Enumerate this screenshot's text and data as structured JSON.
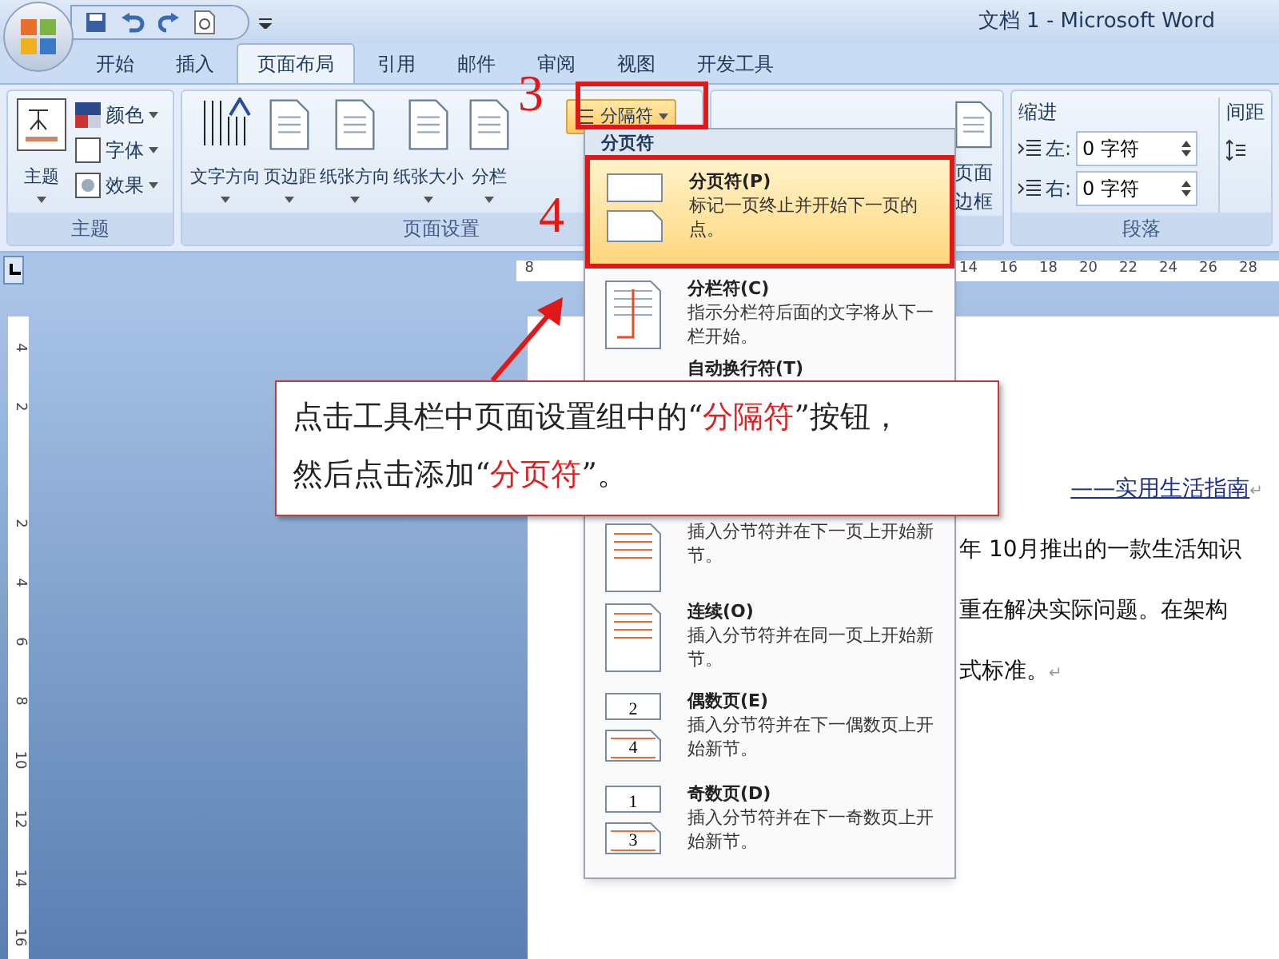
{
  "title_bar": {
    "title": "文档 1 - Microsoft Word"
  },
  "tabs": [
    {
      "label": "开始",
      "selected": false
    },
    {
      "label": "插入",
      "selected": false
    },
    {
      "label": "页面布局",
      "selected": true
    },
    {
      "label": "引用",
      "selected": false
    },
    {
      "label": "邮件",
      "selected": false
    },
    {
      "label": "审阅",
      "selected": false
    },
    {
      "label": "视图",
      "selected": false
    },
    {
      "label": "开发工具",
      "selected": false
    }
  ],
  "ribbon": {
    "theme_group": {
      "label": "主题",
      "big_button": "主题",
      "small_buttons": [
        "颜色",
        "字体",
        "效果"
      ]
    },
    "page_setup_group": {
      "label": "页面设置",
      "buttons": [
        "文字方向",
        "页边距",
        "纸张方向",
        "纸张大小",
        "分栏"
      ],
      "breaks_button": "分隔符"
    },
    "page_background_group": {
      "page_borders_button": "页面边框"
    },
    "paragraph_group": {
      "label": "段落",
      "indent_label": "缩进",
      "indent_fields": [
        {
          "label": "左:",
          "value": "0 字符"
        },
        {
          "label": "右:",
          "value": "0 字符"
        }
      ],
      "spacing_label": "间距"
    }
  },
  "ruler": {
    "top_first": "8",
    "top_numbers": [
      "14",
      "16",
      "18",
      "20",
      "22",
      "24",
      "26",
      "28"
    ],
    "left_numbers": [
      "4",
      "2",
      "2",
      "4",
      "6",
      "8",
      "10",
      "12",
      "14",
      "16"
    ]
  },
  "document": {
    "lines": [
      {
        "kind": "title",
        "text": "——实用生活指南",
        "mark": "↵"
      },
      {
        "kind": "body",
        "text": "年 10月推出的一款生活知识"
      },
      {
        "kind": "body",
        "text": "重在解决实际问题。在架构"
      },
      {
        "kind": "body",
        "text": "式标准。",
        "mark": "↵"
      }
    ]
  },
  "breaks_menu": {
    "header": "分页符",
    "items": [
      {
        "kind": "page",
        "title": "分页符(P)",
        "description": "标记一页终止并开始下一页的点。",
        "selected": true
      },
      {
        "kind": "column",
        "title": "分栏符(C)",
        "description": "指示分栏符后面的文字将从下一栏开始。",
        "selected": false
      },
      {
        "kind": "wrap",
        "title": "自动换行符(T)",
        "selected": false
      },
      {
        "kind": "next",
        "description": "插入分节符并在下一页上开始新节。",
        "selected": false
      },
      {
        "kind": "continuous",
        "title": "连续(O)",
        "description": "插入分节符并在同一页上开始新节。",
        "selected": false
      },
      {
        "kind": "even",
        "title": "偶数页(E)",
        "description": "插入分节符并在下一偶数页上开始新节。",
        "icon_numbers": [
          "2",
          "4"
        ],
        "selected": false
      },
      {
        "kind": "odd",
        "title": "奇数页(D)",
        "description": "插入分节符并在下一奇数页上开始新节。",
        "icon_numbers": [
          "1",
          "3"
        ],
        "selected": false
      }
    ]
  },
  "annotations": {
    "step_labels": [
      "3",
      "4"
    ],
    "callout": {
      "lines": [
        [
          {
            "text": "点击工具栏中页面设置组中的“"
          },
          {
            "text": "分隔符",
            "highlight": true
          },
          {
            "text": "”按钮，"
          }
        ],
        [
          {
            "text": "然后点击添加“"
          },
          {
            "text": "分页符",
            "highlight": true
          },
          {
            "text": "”。"
          }
        ]
      ]
    }
  }
}
